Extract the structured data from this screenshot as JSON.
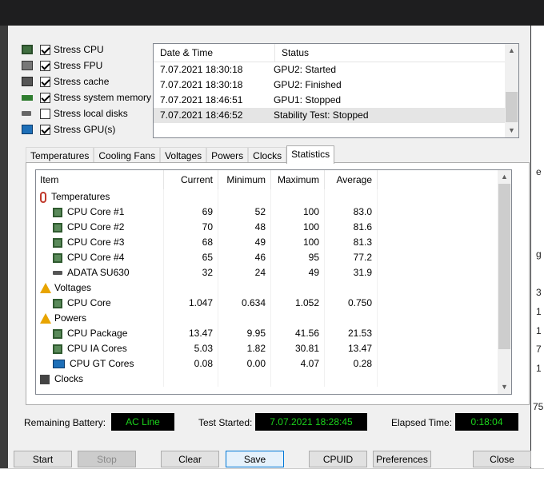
{
  "stress_options": [
    {
      "icon": "cpu-icon",
      "label": "Stress CPU",
      "checked": true
    },
    {
      "icon": "fpu-icon",
      "label": "Stress FPU",
      "checked": true
    },
    {
      "icon": "cache-icon",
      "label": "Stress cache",
      "checked": true
    },
    {
      "icon": "memory-icon",
      "label": "Stress system memory",
      "checked": true
    },
    {
      "icon": "disk-icon",
      "label": "Stress local disks",
      "checked": false
    },
    {
      "icon": "gpu-icon",
      "label": "Stress GPU(s)",
      "checked": true
    }
  ],
  "log": {
    "headers": [
      "Date & Time",
      "Status"
    ],
    "rows": [
      {
        "time": "7.07.2021 18:30:18",
        "status": "GPU2: Started"
      },
      {
        "time": "7.07.2021 18:30:18",
        "status": "GPU2: Finished"
      },
      {
        "time": "7.07.2021 18:46:51",
        "status": "GPU1: Stopped"
      },
      {
        "time": "7.07.2021 18:46:52",
        "status": "Stability Test: Stopped",
        "selected": true
      }
    ]
  },
  "tabs": [
    {
      "label": "Temperatures",
      "active": false
    },
    {
      "label": "Cooling Fans",
      "active": false
    },
    {
      "label": "Voltages",
      "active": false
    },
    {
      "label": "Powers",
      "active": false
    },
    {
      "label": "Clocks",
      "active": false
    },
    {
      "label": "Statistics",
      "active": true
    }
  ],
  "stats": {
    "headers": [
      "Item",
      "Current",
      "Minimum",
      "Maximum",
      "Average"
    ],
    "rows": [
      {
        "type": "group",
        "icon": "thermometer-icon",
        "label": "Temperatures"
      },
      {
        "type": "item",
        "icon": "cpu-icon",
        "label": "CPU Core #1",
        "current": "69",
        "minimum": "52",
        "maximum": "100",
        "average": "83.0"
      },
      {
        "type": "item",
        "icon": "cpu-icon",
        "label": "CPU Core #2",
        "current": "70",
        "minimum": "48",
        "maximum": "100",
        "average": "81.6"
      },
      {
        "type": "item",
        "icon": "cpu-icon",
        "label": "CPU Core #3",
        "current": "68",
        "minimum": "49",
        "maximum": "100",
        "average": "81.3"
      },
      {
        "type": "item",
        "icon": "cpu-icon",
        "label": "CPU Core #4",
        "current": "65",
        "minimum": "46",
        "maximum": "95",
        "average": "77.2"
      },
      {
        "type": "item",
        "icon": "disk-icon",
        "label": "ADATA SU630",
        "current": "32",
        "minimum": "24",
        "maximum": "49",
        "average": "31.9"
      },
      {
        "type": "group",
        "icon": "warning-icon",
        "label": "Voltages"
      },
      {
        "type": "item",
        "icon": "cpu-icon",
        "label": "CPU Core",
        "current": "1.047",
        "minimum": "0.634",
        "maximum": "1.052",
        "average": "0.750"
      },
      {
        "type": "group",
        "icon": "warning-icon",
        "label": "Powers"
      },
      {
        "type": "item",
        "icon": "cpu-icon",
        "label": "CPU Package",
        "current": "13.47",
        "minimum": "9.95",
        "maximum": "41.56",
        "average": "21.53"
      },
      {
        "type": "item",
        "icon": "cpu-icon",
        "label": "CPU IA Cores",
        "current": "5.03",
        "minimum": "1.82",
        "maximum": "30.81",
        "average": "13.47"
      },
      {
        "type": "item",
        "icon": "gpu-icon",
        "label": "CPU GT Cores",
        "current": "0.08",
        "minimum": "0.00",
        "maximum": "4.07",
        "average": "0.28"
      },
      {
        "type": "group",
        "icon": "clock-icon",
        "label": "Clocks"
      }
    ]
  },
  "status": {
    "battery_label": "Remaining Battery:",
    "battery_value": "AC Line",
    "started_label": "Test Started:",
    "started_value": "7.07.2021 18:28:45",
    "elapsed_label": "Elapsed Time:",
    "elapsed_value": "0:18:04"
  },
  "buttons": {
    "start": "Start",
    "stop": "Stop",
    "clear": "Clear",
    "save": "Save",
    "cpuid": "CPUID",
    "preferences": "Preferences",
    "close": "Close"
  },
  "background_fragments": {
    "e": "e",
    "g": "g",
    "n3": "3",
    "n1a": "1",
    "n1b": "1",
    "n7": "7",
    "n1c": "1",
    "n75": "75"
  },
  "colors": {
    "status_box_bg": "#000000",
    "status_box_text": "#1bd31b"
  }
}
